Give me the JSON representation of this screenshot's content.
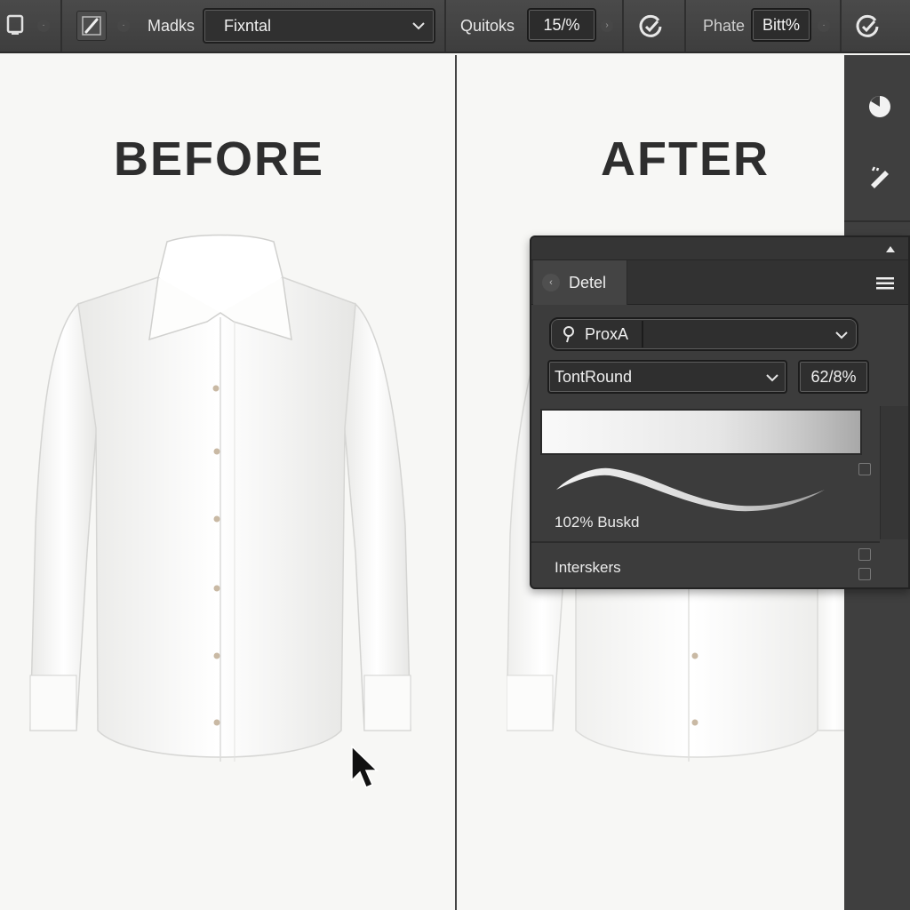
{
  "toolbar": {
    "masks_label": "Madks",
    "masks_value": "Fixntal",
    "outlooks_label": "Quitoks",
    "outlooks_value": "15/%",
    "phate_label": "Phate",
    "phate_value": "Bitt%"
  },
  "canvas": {
    "before_heading": "BEFORE",
    "after_heading": "AFTER"
  },
  "panel": {
    "tab_label": "Detel",
    "profile_select": "ProxA",
    "brush_select": "TontRound",
    "brush_value": "62/8%",
    "stroke_caption": "102% Buskd",
    "section_label": "Interskers"
  },
  "colors": {
    "toolbar_bg": "#444444",
    "panel_bg": "#3c3c3c",
    "canvas_bg": "#f7f7f5",
    "heading_text": "#2e2e2e"
  },
  "icons": [
    "brush-icon",
    "check-circle-icon",
    "dropdown-chevron-icon",
    "pie-chart-icon",
    "pen-tool-icon",
    "menu-icon",
    "pin-icon",
    "collapse-arrow-icon",
    "mouse-cursor-icon"
  ]
}
